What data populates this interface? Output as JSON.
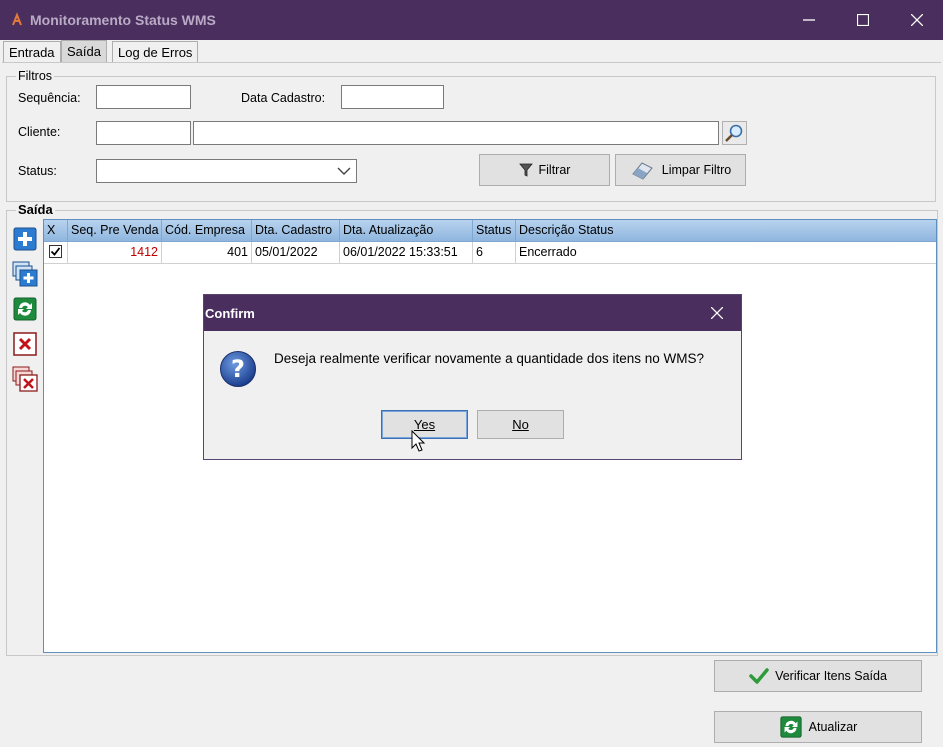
{
  "window": {
    "title": "Monitoramento Status WMS",
    "controls": {
      "minimize": "—",
      "maximize": "☐",
      "close": "✕"
    }
  },
  "tabs": [
    {
      "label": "Entrada",
      "active": false
    },
    {
      "label": "Saída",
      "active": true
    },
    {
      "label": "Log de Erros",
      "active": false
    }
  ],
  "filters": {
    "group_label": "Filtros",
    "sequencia_label": "Sequência:",
    "sequencia_value": "",
    "data_cadastro_label": "Data Cadastro:",
    "data_cadastro_value": "",
    "cliente_label": "Cliente:",
    "cliente_code": "",
    "cliente_name": "",
    "status_label": "Status:",
    "status_value": "",
    "filtrar_label": "Filtrar",
    "limpar_label": "Limpar Filtro"
  },
  "saida": {
    "group_label": "Saída",
    "columns": [
      "X",
      "Seq. Pre Venda",
      "Cód. Empresa",
      "Dta. Cadastro",
      "Dta. Atualização",
      "Status",
      "Descrição Status"
    ],
    "rows": [
      {
        "checked": true,
        "seq": "1412",
        "empresa": "401",
        "dta_cadastro": "05/01/2022",
        "dta_atualizacao": "06/01/2022 15:33:51",
        "status": "6",
        "descricao": "Encerrado"
      }
    ],
    "side_icons": [
      "add-icon",
      "add-multiple-icon",
      "refresh-icon",
      "delete-icon",
      "delete-multiple-icon"
    ]
  },
  "buttons": {
    "verificar_label": "Verificar Itens Saída",
    "atualizar_label": "Atualizar"
  },
  "dialog": {
    "title": "Confirm",
    "message": "Deseja realmente verificar novamente a quantidade dos itens no WMS?",
    "yes_label": "Yes",
    "no_label": "No",
    "icon": "question-icon"
  },
  "colors": {
    "titlebar": "#4a2f5e",
    "grid_header": "#9dc0e6",
    "seq_value": "#c00000"
  }
}
